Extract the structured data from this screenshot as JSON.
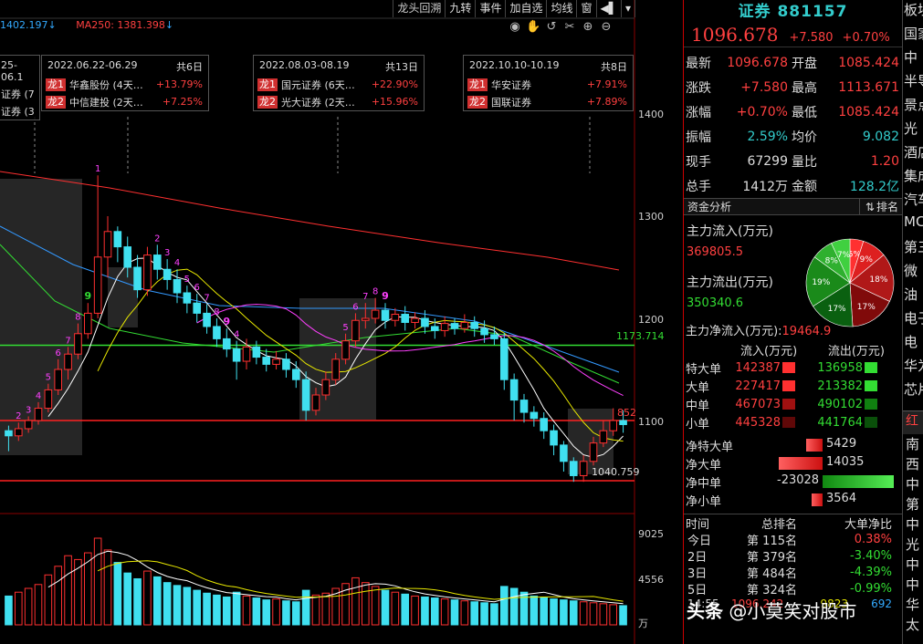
{
  "toolbar": [
    "龙头回溯",
    "九转",
    "事件",
    "加自选",
    "均线",
    "窗"
  ],
  "ma_readout": [
    {
      "text": "1402.197",
      "color": "#33aaff"
    },
    {
      "text": "MA250: 1381.398",
      "color": "#ff4040"
    }
  ],
  "ma_arrows": [
    "↓",
    "↓"
  ],
  "events": [
    {
      "date": "25-06.1",
      "days": "",
      "rows": [
        {
          "tag": "",
          "name": "证券 (7",
          "pct": ""
        },
        {
          "tag": "",
          "name": "证券 (3",
          "pct": ""
        }
      ]
    },
    {
      "date": "2022.06.22-06.29",
      "days": "共6日",
      "rows": [
        {
          "tag": "龙1",
          "name": "华鑫股份 (4天…",
          "pct": "+13.79%"
        },
        {
          "tag": "龙2",
          "name": "中信建投 (2天…",
          "pct": "+7.25%"
        }
      ]
    },
    {
      "date": "2022.08.03-08.19",
      "days": "共13日",
      "rows": [
        {
          "tag": "龙1",
          "name": "国元证券 (6天…",
          "pct": "+22.90%"
        },
        {
          "tag": "龙2",
          "name": "光大证券 (2天…",
          "pct": "+15.96%"
        }
      ]
    },
    {
      "date": "2022.10.10-10.19",
      "days": "共8日",
      "rows": [
        {
          "tag": "龙1",
          "name": "华安证券",
          "pct": "+7.91%"
        },
        {
          "tag": "龙2",
          "name": "国联证券",
          "pct": "+7.89%"
        }
      ]
    }
  ],
  "price_axis": [
    "1400",
    "1300",
    "1200",
    "1100"
  ],
  "vol_axis": [
    "9025",
    "4556",
    "万"
  ],
  "level_labels": {
    "upper": "1173.714",
    "lower": "1040.759",
    "right": "852"
  },
  "nine_turn": [
    "2",
    "3",
    "4",
    "5",
    "6",
    "7",
    "8",
    "9",
    "1",
    "2",
    "3",
    "4",
    "5",
    "6",
    "7",
    "8",
    "9",
    "4",
    "5",
    "6",
    "7",
    "8",
    "9"
  ],
  "quote": {
    "title": "证券 881157",
    "price": "1096.678",
    "change": "+7.580",
    "change_pct": "+0.70%",
    "rows": [
      {
        "k1": "最新",
        "v1": "1096.678",
        "c1": "red",
        "k2": "开盘",
        "v2": "1085.424",
        "c2": "red"
      },
      {
        "k1": "涨跌",
        "v1": "+7.580",
        "c1": "red",
        "k2": "最高",
        "v2": "1113.671",
        "c2": "red"
      },
      {
        "k1": "涨幅",
        "v1": "+0.70%",
        "c1": "red",
        "k2": "最低",
        "v2": "1085.424",
        "c2": "red"
      },
      {
        "k1": "振幅",
        "v1": "2.59%",
        "c1": "cyan",
        "k2": "均价",
        "v2": "9.082",
        "c2": "cyan"
      },
      {
        "k1": "现手",
        "v1": "67299",
        "c1": "white",
        "k2": "量比",
        "v2": "1.20",
        "c2": "red"
      },
      {
        "k1": "总手",
        "v1": "1412万",
        "c1": "white",
        "k2": "金额",
        "v2": "128.2亿",
        "c2": "cyan"
      }
    ]
  },
  "capital": {
    "section_title": "资金分析",
    "rank_btn": "排名",
    "inflow_label": "主力流入(万元)",
    "inflow_value": "369805.5",
    "outflow_label": "主力流出(万元)",
    "outflow_value": "350340.6",
    "net_label": "主力净流入(万元):",
    "net_value": "19464.9",
    "pie": [
      {
        "label": "5%",
        "value": 5,
        "color": "#ff3030"
      },
      {
        "label": "9%",
        "value": 9,
        "color": "#dd2020"
      },
      {
        "label": "18%",
        "value": 18,
        "color": "#b01818"
      },
      {
        "label": "17%",
        "value": 17,
        "color": "#800a0a"
      },
      {
        "label": "17%",
        "value": 17,
        "color": "#0a6010"
      },
      {
        "label": "19%",
        "value": 19,
        "color": "#1a8a1a"
      },
      {
        "label": "8%",
        "value": 8,
        "color": "#2fb02f"
      },
      {
        "label": "7%",
        "value": 7,
        "color": "#40d040"
      }
    ]
  },
  "flow": {
    "headers": [
      "流入(万元)",
      "流出(万元)"
    ],
    "rows": [
      {
        "name": "特大单",
        "in": "142387",
        "out": "136958"
      },
      {
        "name": "大单",
        "in": "227417",
        "out": "213382"
      },
      {
        "name": "中单",
        "in": "467073",
        "out": "490102"
      },
      {
        "name": "小单",
        "in": "445328",
        "out": "441764"
      }
    ]
  },
  "net_flow": [
    {
      "name": "净特大单",
      "value": "5429",
      "amount": 5429
    },
    {
      "name": "净大单",
      "value": "14035",
      "amount": 14035
    },
    {
      "name": "净中单",
      "value": "-23028",
      "amount": -23028
    },
    {
      "name": "净小单",
      "value": "3564",
      "amount": 3564
    }
  ],
  "ranking": {
    "headers": [
      "时间",
      "总排名",
      "大单净比"
    ],
    "rows": [
      {
        "time": "今日",
        "rank": "第  115名",
        "ratio": "0.38%",
        "c": "red"
      },
      {
        "time": "2日",
        "rank": "第  379名",
        "ratio": "-3.40%",
        "c": "green"
      },
      {
        "time": "3日",
        "rank": "第  484名",
        "ratio": "-4.39%",
        "c": "green"
      },
      {
        "time": "5日",
        "rank": "第  324名",
        "ratio": "-0.99%",
        "c": "green"
      }
    ]
  },
  "ticks": [
    {
      "time": "14:55",
      "price": "1096.242",
      "vol": "9823",
      "n": "692"
    }
  ],
  "sidebar": {
    "items": [
      "板块",
      "国家",
      "中",
      "半导",
      "景点",
      "光",
      "酒店",
      "集成",
      "汽车",
      "MC",
      "第三",
      "微",
      "油",
      "电子",
      "电",
      "华为",
      "芯片"
    ],
    "tab": "红",
    "items2": [
      "南",
      "西",
      "中",
      "第",
      "中",
      "光",
      "中",
      "中",
      "华",
      "太"
    ]
  },
  "watermark": {
    "logo": "头条",
    "text": "@小莫笑对股市"
  },
  "chart_data": {
    "type": "candlestick",
    "title": "证券 881157",
    "price_range": [
      1030,
      1430
    ],
    "levels": [
      1173.714,
      1100,
      1040.759
    ],
    "candles": [
      [
        1090,
        1085,
        1070,
        1095
      ],
      [
        1085,
        1092,
        1080,
        1098
      ],
      [
        1092,
        1100,
        1088,
        1104
      ],
      [
        1100,
        1112,
        1096,
        1118
      ],
      [
        1112,
        1130,
        1108,
        1136
      ],
      [
        1130,
        1150,
        1125,
        1160
      ],
      [
        1150,
        1165,
        1140,
        1172
      ],
      [
        1165,
        1185,
        1160,
        1195
      ],
      [
        1185,
        1205,
        1180,
        1215
      ],
      [
        1205,
        1260,
        1200,
        1340
      ],
      [
        1260,
        1285,
        1240,
        1300
      ],
      [
        1285,
        1270,
        1255,
        1290
      ],
      [
        1270,
        1250,
        1240,
        1280
      ],
      [
        1250,
        1228,
        1220,
        1262
      ],
      [
        1228,
        1262,
        1222,
        1270
      ],
      [
        1262,
        1248,
        1238,
        1272
      ],
      [
        1248,
        1238,
        1228,
        1258
      ],
      [
        1238,
        1225,
        1215,
        1248
      ],
      [
        1225,
        1215,
        1205,
        1232
      ],
      [
        1215,
        1205,
        1196,
        1224
      ],
      [
        1205,
        1192,
        1185,
        1214
      ],
      [
        1192,
        1180,
        1172,
        1200
      ],
      [
        1180,
        1170,
        1162,
        1190
      ],
      [
        1170,
        1158,
        1140,
        1178
      ],
      [
        1158,
        1172,
        1150,
        1180
      ],
      [
        1172,
        1162,
        1155,
        1178
      ],
      [
        1162,
        1155,
        1148,
        1170
      ],
      [
        1155,
        1160,
        1150,
        1168
      ],
      [
        1160,
        1150,
        1142,
        1166
      ],
      [
        1150,
        1140,
        1132,
        1158
      ],
      [
        1140,
        1110,
        1100,
        1148
      ],
      [
        1110,
        1125,
        1105,
        1132
      ],
      [
        1125,
        1140,
        1120,
        1148
      ],
      [
        1140,
        1160,
        1135,
        1166
      ],
      [
        1160,
        1178,
        1155,
        1185
      ],
      [
        1178,
        1198,
        1172,
        1205
      ],
      [
        1198,
        1200,
        1190,
        1215
      ],
      [
        1200,
        1208,
        1195,
        1220
      ],
      [
        1208,
        1198,
        1190,
        1215
      ],
      [
        1198,
        1204,
        1192,
        1210
      ],
      [
        1204,
        1196,
        1188,
        1212
      ],
      [
        1196,
        1200,
        1190,
        1206
      ],
      [
        1200,
        1192,
        1185,
        1208
      ],
      [
        1192,
        1188,
        1180,
        1200
      ],
      [
        1188,
        1195,
        1182,
        1202
      ],
      [
        1195,
        1190,
        1184,
        1200
      ],
      [
        1190,
        1196,
        1186,
        1204
      ],
      [
        1196,
        1190,
        1182,
        1202
      ],
      [
        1190,
        1184,
        1176,
        1198
      ],
      [
        1184,
        1180,
        1174,
        1192
      ],
      [
        1180,
        1140,
        1130,
        1186
      ],
      [
        1140,
        1120,
        1100,
        1146
      ],
      [
        1120,
        1108,
        1098,
        1126
      ],
      [
        1108,
        1102,
        1094,
        1114
      ],
      [
        1102,
        1090,
        1082,
        1108
      ],
      [
        1090,
        1076,
        1066,
        1096
      ],
      [
        1076,
        1060,
        1050,
        1080
      ],
      [
        1060,
        1046,
        1040,
        1064
      ],
      [
        1046,
        1060,
        1040,
        1066
      ],
      [
        1060,
        1078,
        1056,
        1084
      ],
      [
        1078,
        1090,
        1074,
        1100
      ],
      [
        1090,
        1100,
        1085,
        1112
      ],
      [
        1100,
        1096,
        1088,
        1110
      ]
    ],
    "volumes": [
      3000,
      3400,
      3800,
      4200,
      5200,
      6100,
      7200,
      6800,
      7500,
      9025,
      7800,
      6500,
      5400,
      4800,
      5600,
      5000,
      4400,
      4100,
      3900,
      3600,
      3300,
      3100,
      2900,
      3400,
      3000,
      2800,
      2600,
      2700,
      2500,
      2400,
      3600,
      3100,
      3300,
      3800,
      4300,
      4900,
      4400,
      4000,
      3600,
      3400,
      3200,
      3000,
      2900,
      2800,
      2700,
      2600,
      2500,
      2400,
      2300,
      2200,
      4000,
      3800,
      3400,
      3000,
      2800,
      2700,
      2600,
      2500,
      2400,
      2300,
      2200,
      2100,
      2000
    ],
    "ma_series_colors": [
      "#ffffff",
      "#e8e800",
      "#ff40ff",
      "#33dd33",
      "#3399ff",
      "#ff4040"
    ]
  }
}
